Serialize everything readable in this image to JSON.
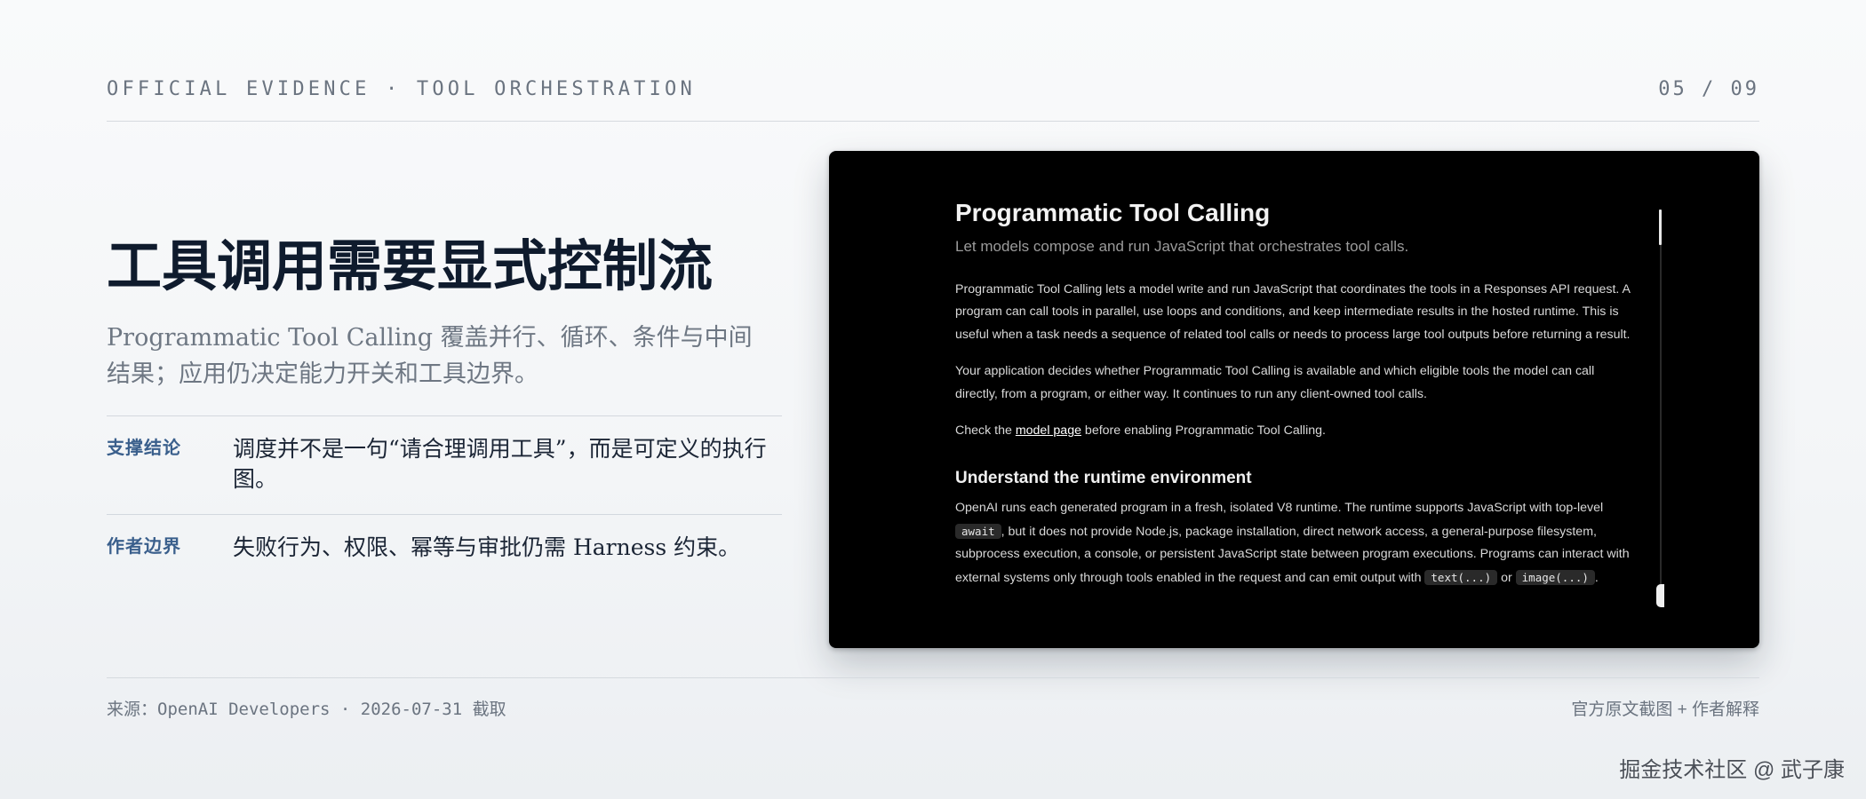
{
  "header": {
    "kicker": "OFFICIAL EVIDENCE · TOOL ORCHESTRATION",
    "page_counter": "05 / 09"
  },
  "main": {
    "title": "工具调用需要显式控制流",
    "subtitle": "Programmatic Tool Calling 覆盖并行、循环、条件与中间结果；应用仍决定能力开关和工具边界。",
    "points": [
      {
        "label": "支撑结论",
        "text": "调度并不是一句“请合理调用工具”，而是可定义的执行图。"
      },
      {
        "label": "作者边界",
        "text": "失败行为、权限、幂等与审批仍需 Harness 约束。"
      }
    ]
  },
  "screenshot": {
    "title": "Programmatic Tool Calling",
    "subtitle": "Let models compose and run JavaScript that orchestrates tool calls.",
    "paragraph_1": "Programmatic Tool Calling lets a model write and run JavaScript that coordinates the tools in a Responses API request. A program can call tools in parallel, use loops and conditions, and keep intermediate results in the hosted runtime. This is useful when a task needs a sequence of related tool calls or needs to process large tool outputs before returning a result.",
    "paragraph_2": "Your application decides whether Programmatic Tool Calling is available and which eligible tools the model can call directly, from a program, or either way. It continues to run any client-owned tool calls.",
    "check_prefix": "Check the ",
    "check_link": "model page",
    "check_suffix": " before enabling Programmatic Tool Calling.",
    "section_heading": "Understand the runtime environment",
    "runtime_1": "OpenAI runs each generated program in a fresh, isolated V8 runtime. The runtime supports JavaScript with top-level ",
    "code_await": "await",
    "runtime_2": ", but it does not provide Node.js, package installation, direct network access, a general-purpose filesystem, subprocess execution, a console, or persistent JavaScript state between program executions. Programs can interact with external systems only through tools enabled in the request and can emit output with ",
    "code_text": "text(...)",
    "runtime_or": " or ",
    "code_image": "image(...)",
    "runtime_end": "."
  },
  "footer": {
    "source_label": "来源：",
    "source_value": "OpenAI Developers · 2026-07-31 ",
    "source_suffix": "截取",
    "right": "官方原文截图 + 作者解释"
  },
  "watermark": "掘金技术社区 @ 武子康"
}
